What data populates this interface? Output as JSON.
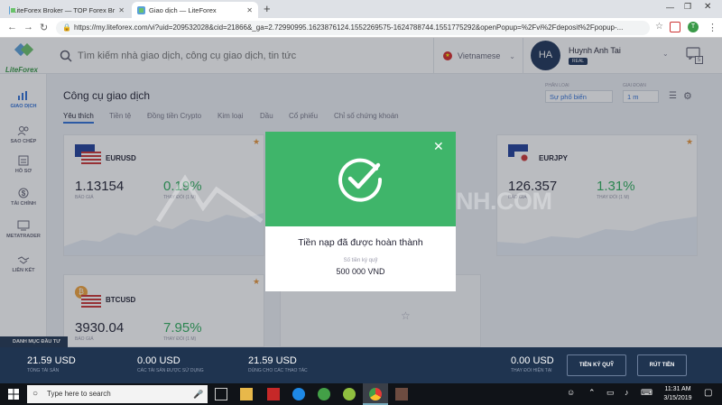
{
  "browser": {
    "tabs": [
      {
        "title": "LiteForex Broker — TOP Forex Br"
      },
      {
        "title": "Giao dịch — LiteForex"
      }
    ],
    "new_tab": "+",
    "url": "https://my.liteforex.com/vi?uid=209532028&cid=21866&_ga=2.72990995.1623876124.1552269575-1624788744.1551775292&openPopup=%2Fvi%2Fdeposit%2Fpopup-..."
  },
  "header": {
    "logo_text": "LiteForex",
    "search_placeholder": "Tìm kiếm nhà giao dịch, công cụ giao dịch, tin tức",
    "language": "Vietnamese",
    "user": {
      "initials": "HA",
      "name": "Huynh Anh Tai",
      "badge": "REAL"
    },
    "notif_count": "5"
  },
  "sidebar": {
    "items": [
      {
        "label": "GIAO DỊCH",
        "icon": "chart-icon"
      },
      {
        "label": "SAO CHÉP",
        "icon": "users-icon"
      },
      {
        "label": "HỒ SƠ",
        "icon": "profile-icon"
      },
      {
        "label": "TÀI CHÍNH",
        "icon": "dollar-icon"
      },
      {
        "label": "METATRADER",
        "icon": "monitor-icon"
      },
      {
        "label": "LIÊN KẾT",
        "icon": "handshake-icon"
      }
    ],
    "portfolio_tab": "DANH MỤC ĐẦU TƯ"
  },
  "main": {
    "title": "Công cụ giao dịch",
    "tabs": [
      "Yêu thích",
      "Tiền tệ",
      "Đồng tiền Crypto",
      "Kim loại",
      "Dầu",
      "Cổ phiếu",
      "Chỉ số chứng khoán"
    ],
    "filter": {
      "label": "PHÂN LOẠI",
      "value": "Sự phổ biến"
    },
    "period": {
      "label": "GIAI ĐOẠN",
      "value": "1 m"
    },
    "cards": [
      {
        "pair": "EURUSD",
        "price": "1.13154",
        "price_label": "BÁO GIÁ",
        "change": "0.19%",
        "change_label": "THAY ĐỔI (1 M)"
      },
      {
        "pair": "EURJPY",
        "price": "126.357",
        "price_label": "BÁO GIÁ",
        "change": "1.31%",
        "change_label": "THAY ĐỔI (1 M)"
      },
      {
        "pair": "BTCUSD",
        "price": "3930.04",
        "price_label": "BÁO GIÁ",
        "change": "7.95%",
        "change_label": "THAY ĐỔI (1 M)"
      }
    ]
  },
  "watermark": "THUVIENTAICHINH.COM",
  "modal": {
    "close": "✕",
    "message": "Tiền nạp đã được hoàn thành",
    "amount_label": "Số tiền ký quỹ",
    "amount": "500 000 VND"
  },
  "bottom": {
    "balance": {
      "value": "21.59 USD",
      "label": "TỔNG TÀI SẢN"
    },
    "used": {
      "value": "0.00 USD",
      "label": "CÁC TÀI SẢN ĐƯỢC SỬ DỤNG"
    },
    "available": {
      "value": "21.59 USD",
      "label": "DÙNG CHO CÁC THAO TÁC"
    },
    "change": {
      "value": "0.00 USD",
      "label": "THAY ĐỔI HIỆN TẠI"
    },
    "deposit_button": "TIỀN KÝ QUỸ",
    "withdraw_button": "RÚT TIỀN"
  },
  "taskbar": {
    "search_placeholder": "Type here to search",
    "time": "11:31 AM",
    "date": "3/15/2019"
  },
  "colors": {
    "green": "#3fb56a",
    "navy": "#1f3450",
    "accent": "#2f6fd6",
    "star": "#e8953a"
  }
}
